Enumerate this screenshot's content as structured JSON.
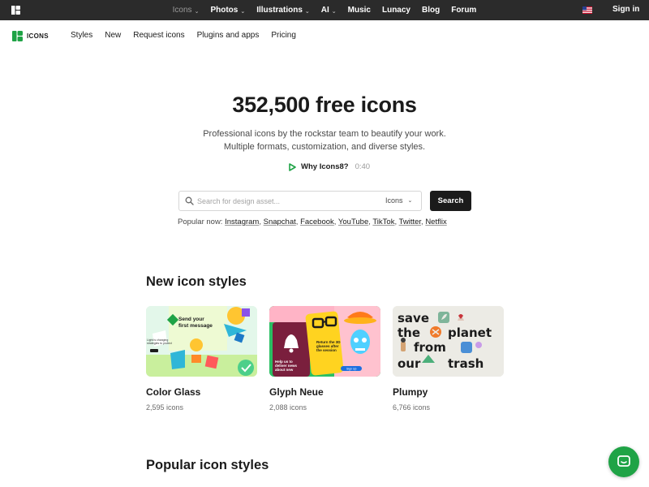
{
  "topbar": {
    "nav": [
      {
        "label": "Icons",
        "has_chevron": true,
        "muted": true
      },
      {
        "label": "Photos",
        "has_chevron": true
      },
      {
        "label": "Illustrations",
        "has_chevron": true
      },
      {
        "label": "AI",
        "has_chevron": true
      },
      {
        "label": "Music",
        "has_chevron": false
      },
      {
        "label": "Lunacy",
        "has_chevron": false
      },
      {
        "label": "Blog",
        "has_chevron": false
      },
      {
        "label": "Forum",
        "has_chevron": false
      }
    ],
    "language_icon": "us-flag-icon",
    "signin_label": "Sign in"
  },
  "subnav": {
    "brand": "ICONS",
    "links": [
      "Styles",
      "New",
      "Request icons",
      "Plugins and apps",
      "Pricing"
    ]
  },
  "hero": {
    "title": "352,500 free icons",
    "subtitle_line1": "Professional icons by the rockstar team to beautify your work.",
    "subtitle_line2": "Multiple formats, customization, and diverse styles.",
    "why_label": "Why Icons8?",
    "why_time": "0:40"
  },
  "search": {
    "placeholder": "Search for design asset...",
    "value": "",
    "type_selected": "Icons",
    "button_label": "Search",
    "popular_label": "Popular now:",
    "popular_items": [
      "Instagram",
      "Snapchat",
      "Facebook",
      "YouTube",
      "TikTok",
      "Twitter",
      "Netflix"
    ]
  },
  "new_styles": {
    "title": "New icon styles",
    "cards": [
      {
        "name": "Color Glass",
        "count": "2,595 icons",
        "thumb_text": "Send your first message"
      },
      {
        "name": "Glyph Neue",
        "count": "2,088 icons",
        "thumb_text_a": "Return the 3D glasses after the session",
        "thumb_text_b": "Help us to deliver news about new"
      },
      {
        "name": "Plumpy",
        "count": "6,766 icons",
        "thumb_line1": "save",
        "thumb_line2a": "the",
        "thumb_line2b": "planet",
        "thumb_line3": "from",
        "thumb_line4a": "our",
        "thumb_line4b": "trash"
      }
    ]
  },
  "popular_styles": {
    "title": "Popular icon styles"
  },
  "colors": {
    "topbar_bg": "#2b2b2b",
    "brand_green": "#1fa346",
    "search_button_bg": "#1b1b1b"
  }
}
